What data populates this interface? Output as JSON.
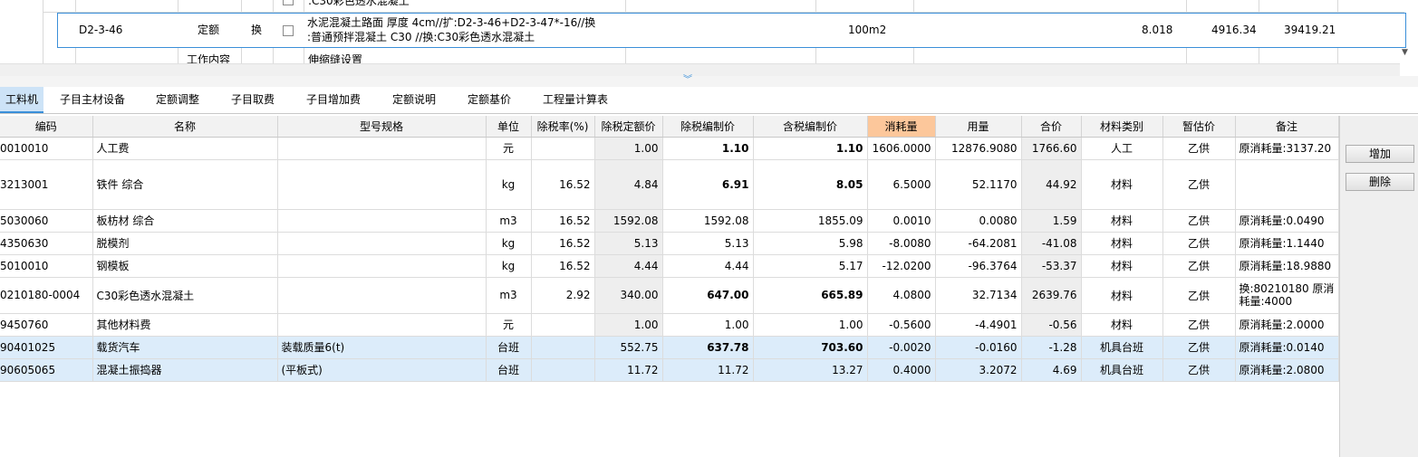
{
  "upper": {
    "prev_row_text": ":C30彩色透水混凝土",
    "selected_row": {
      "code": "D2-3-46",
      "type": "定额",
      "flag": "换",
      "name_line1": "水泥混凝土路面 厚度 4cm//扩:D2-3-46+D2-3-47*-16//换",
      "name_line2": ":普通预拌混凝土 C30 //换:C30彩色透水混凝土",
      "unit": "100m2",
      "quantity": "8.018",
      "price": "4916.34",
      "total": "39419.21"
    },
    "next_row": {
      "label": "工作内容",
      "content": "伸缩缝设置"
    }
  },
  "tabs": [
    {
      "label": "工料机",
      "active": true
    },
    {
      "label": "子目主材设备"
    },
    {
      "label": "定额调整"
    },
    {
      "label": "子目取费"
    },
    {
      "label": "子目增加费"
    },
    {
      "label": "定额说明"
    },
    {
      "label": "定额基价"
    },
    {
      "label": "工程量计算表"
    }
  ],
  "columns": [
    "编码",
    "名称",
    "型号规格",
    "单位",
    "除税率(%)",
    "除税定额价",
    "除税编制价",
    "含税编制价",
    "消耗量",
    "用量",
    "合价",
    "材料类别",
    "暂估价",
    "备注"
  ],
  "rows": [
    {
      "code": "0010010",
      "name": "人工费",
      "spec": "",
      "unit": "元",
      "tax_rate": "",
      "quota_price": "1.00",
      "prep_price": "1.10",
      "tax_prep_price": "1.10",
      "consumption": "1606.0000",
      "usage": "12876.9080",
      "total": "1766.60",
      "category": "人工",
      "estimate": "乙供",
      "remark": "原消耗量:3137.20"
    },
    {
      "code": "3213001",
      "name": "铁件 综合",
      "spec": "",
      "unit": "kg",
      "tax_rate": "16.52",
      "quota_price": "4.84",
      "prep_price": "6.91",
      "tax_prep_price": "8.05",
      "consumption": "6.5000",
      "usage": "52.1170",
      "total": "44.92",
      "category": "材料",
      "estimate": "乙供",
      "remark": ""
    },
    {
      "code": "5030060",
      "name": "板枋材 综合",
      "spec": "",
      "unit": "m3",
      "tax_rate": "16.52",
      "quota_price": "1592.08",
      "prep_price": "1592.08",
      "tax_prep_price": "1855.09",
      "consumption": "0.0010",
      "usage": "0.0080",
      "total": "1.59",
      "category": "材料",
      "estimate": "乙供",
      "remark": "原消耗量:0.0490"
    },
    {
      "code": "4350630",
      "name": "脱模剂",
      "spec": "",
      "unit": "kg",
      "tax_rate": "16.52",
      "quota_price": "5.13",
      "prep_price": "5.13",
      "tax_prep_price": "5.98",
      "consumption": "-8.0080",
      "usage": "-64.2081",
      "total": "-41.08",
      "category": "材料",
      "estimate": "乙供",
      "remark": "原消耗量:1.1440"
    },
    {
      "code": "5010010",
      "name": "钢模板",
      "spec": "",
      "unit": "kg",
      "tax_rate": "16.52",
      "quota_price": "4.44",
      "prep_price": "4.44",
      "tax_prep_price": "5.17",
      "consumption": "-12.0200",
      "usage": "-96.3764",
      "total": "-53.37",
      "category": "材料",
      "estimate": "乙供",
      "remark": "原消耗量:18.9880"
    },
    {
      "code": "0210180-0004",
      "name": "C30彩色透水混凝土",
      "spec": "",
      "unit": "m3",
      "tax_rate": "2.92",
      "quota_price": "340.00",
      "prep_price": "647.00",
      "tax_prep_price": "665.89",
      "consumption": "4.0800",
      "usage": "32.7134",
      "total": "2639.76",
      "category": "材料",
      "estimate": "乙供",
      "remark": "换:80210180 原消耗量:4000"
    },
    {
      "code": "9450760",
      "name": "其他材料费",
      "spec": "",
      "unit": "元",
      "tax_rate": "",
      "quota_price": "1.00",
      "prep_price": "1.00",
      "tax_prep_price": "1.00",
      "consumption": "-0.5600",
      "usage": "-4.4901",
      "total": "-0.56",
      "category": "材料",
      "estimate": "乙供",
      "remark": "原消耗量:2.0000"
    },
    {
      "code": "90401025",
      "name": "载货汽车",
      "spec": "装载质量6(t)",
      "unit": "台班",
      "tax_rate": "",
      "quota_price": "552.75",
      "prep_price": "637.78",
      "tax_prep_price": "703.60",
      "consumption": "-0.0020",
      "usage": "-0.0160",
      "total": "-1.28",
      "category": "机具台班",
      "estimate": "乙供",
      "remark": "原消耗量:0.0140"
    },
    {
      "code": "90605065",
      "name": "混凝土振捣器",
      "spec": "(平板式)",
      "unit": "台班",
      "tax_rate": "",
      "quota_price": "11.72",
      "prep_price": "11.72",
      "tax_prep_price": "13.27",
      "consumption": "0.4000",
      "usage": "3.2072",
      "total": "4.69",
      "category": "机具台班",
      "estimate": "乙供",
      "remark": "原消耗量:2.0800"
    }
  ],
  "buttons": {
    "add": "增加",
    "delete": "删除"
  },
  "colors": {
    "selected_border": "#3a8fd9",
    "highlight_header": "#fcc79b",
    "machine_row": "#dcecfa",
    "readonly_cell": "#eeeeee"
  }
}
